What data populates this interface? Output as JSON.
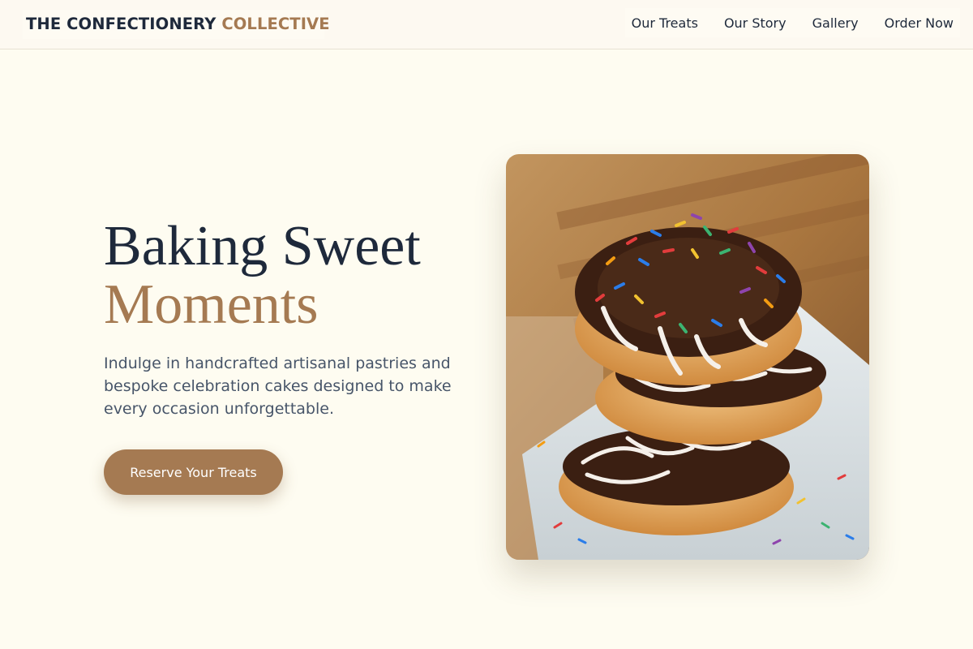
{
  "brand": {
    "name_dark": "THE CONFECTIONERY",
    "name_accent": "COLLECTIVE"
  },
  "nav": {
    "items": [
      {
        "label": "Our Treats"
      },
      {
        "label": "Our Story"
      },
      {
        "label": "Gallery"
      },
      {
        "label": "Order Now"
      }
    ]
  },
  "hero": {
    "title_line1": "Baking Sweet",
    "title_line2": "Moments",
    "description": "Indulge in handcrafted artisanal pastries and bespoke celebration cakes designed to make every occasion unforgettable.",
    "cta_label": "Reserve Your Treats"
  },
  "image": {
    "subject": "stacked-sprinkle-donuts-photo"
  },
  "colors": {
    "background": "#fefcf1",
    "accent": "#a57a52",
    "text_dark": "#1e293b",
    "text_muted": "#475569"
  }
}
